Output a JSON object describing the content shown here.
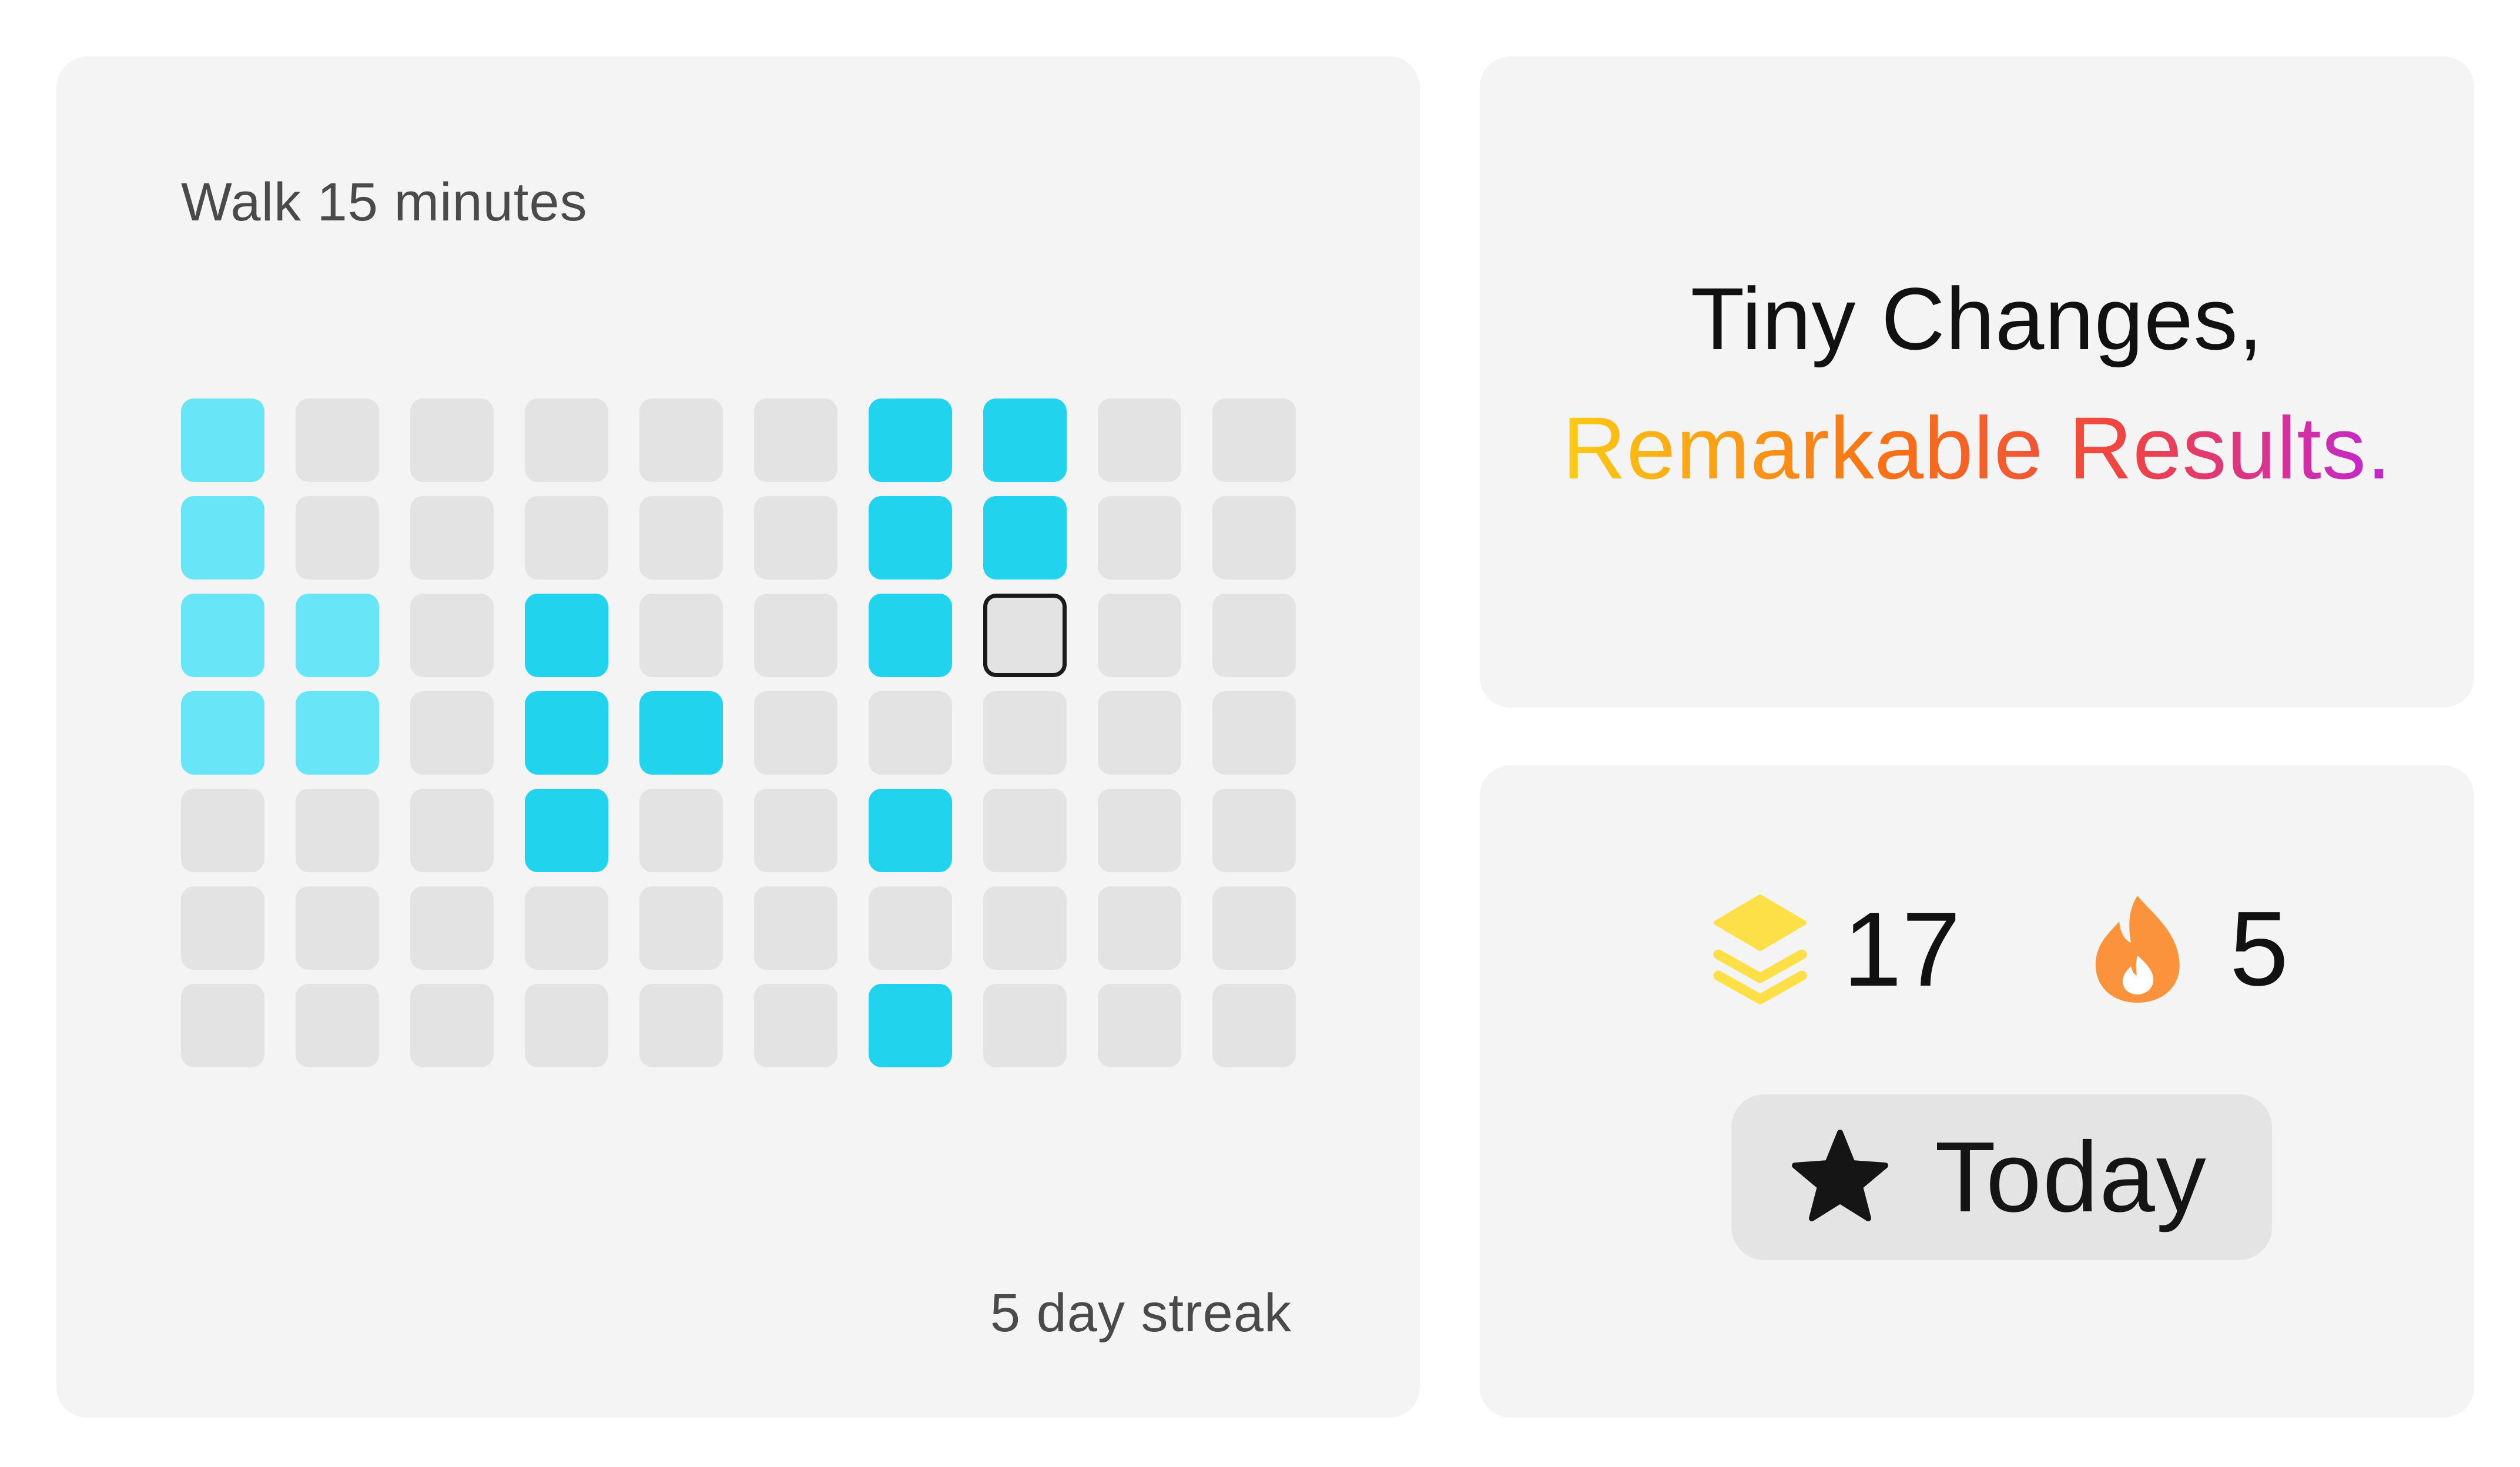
{
  "habit": {
    "title": "Walk 15 minutes",
    "streak_text": "5 day streak",
    "grid": {
      "rows": 7,
      "columns": 10,
      "cells": [
        [
          "light",
          "empty",
          "empty",
          "empty",
          "empty",
          "empty",
          "strong",
          "strong",
          "empty",
          "empty"
        ],
        [
          "light",
          "empty",
          "empty",
          "empty",
          "empty",
          "empty",
          "strong",
          "strong",
          "empty",
          "empty"
        ],
        [
          "light",
          "light",
          "empty",
          "strong",
          "empty",
          "empty",
          "strong",
          "today",
          "empty",
          "empty"
        ],
        [
          "light",
          "light",
          "empty",
          "strong",
          "strong",
          "empty",
          "empty",
          "empty",
          "empty",
          "empty"
        ],
        [
          "empty",
          "empty",
          "empty",
          "strong",
          "empty",
          "empty",
          "strong",
          "empty",
          "empty",
          "empty"
        ],
        [
          "empty",
          "empty",
          "empty",
          "empty",
          "empty",
          "empty",
          "empty",
          "empty",
          "empty",
          "empty"
        ],
        [
          "empty",
          "empty",
          "empty",
          "empty",
          "empty",
          "empty",
          "strong",
          "empty",
          "empty",
          "empty"
        ]
      ]
    }
  },
  "quote": {
    "line1": "Tiny Changes,",
    "line2": "Remarkable Results."
  },
  "stats": {
    "total": {
      "icon": "layers-icon",
      "value": "17"
    },
    "streak": {
      "icon": "fire-icon",
      "value": "5"
    }
  },
  "today_button": {
    "icon": "star-icon",
    "label": "Today"
  },
  "colors": {
    "card_bg": "#f4f4f4",
    "cell_empty": "#e3e3e3",
    "cell_light": "#68e6f7",
    "cell_strong": "#22d3ee",
    "layers_icon": "#fde047",
    "fire_icon": "#fb923c"
  }
}
